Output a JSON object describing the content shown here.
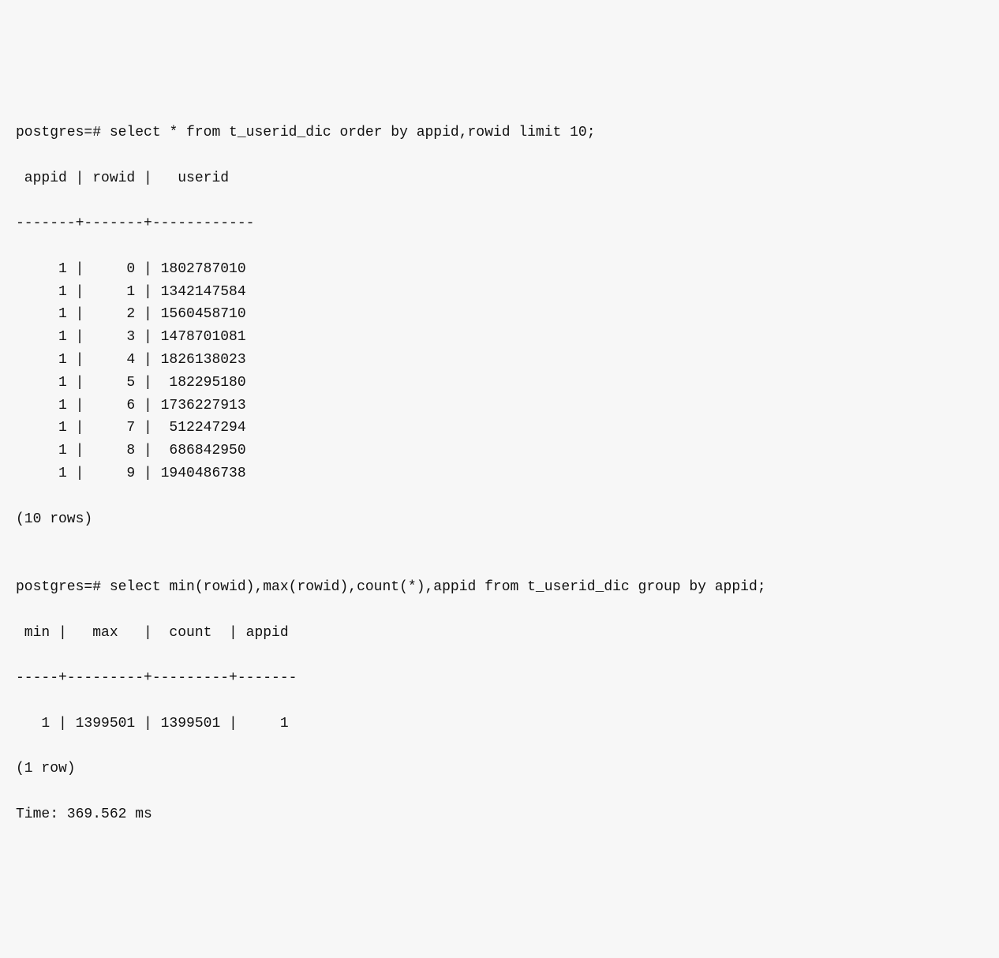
{
  "q1": {
    "prompt": "postgres=# ",
    "sql": "select * from t_userid_dic order by appid,rowid limit 10;",
    "header": " appid | rowid |   userid",
    "separator": "-------+-------+------------",
    "rows": [
      {
        "appid": "1",
        "rowid": "0",
        "userid": "1802787010"
      },
      {
        "appid": "1",
        "rowid": "1",
        "userid": "1342147584"
      },
      {
        "appid": "1",
        "rowid": "2",
        "userid": "1560458710"
      },
      {
        "appid": "1",
        "rowid": "3",
        "userid": "1478701081"
      },
      {
        "appid": "1",
        "rowid": "4",
        "userid": "1826138023"
      },
      {
        "appid": "1",
        "rowid": "5",
        "userid": "182295180"
      },
      {
        "appid": "1",
        "rowid": "6",
        "userid": "1736227913"
      },
      {
        "appid": "1",
        "rowid": "7",
        "userid": "512247294"
      },
      {
        "appid": "1",
        "rowid": "8",
        "userid": "686842950"
      },
      {
        "appid": "1",
        "rowid": "9",
        "userid": "1940486738"
      }
    ],
    "footer": "(10 rows)"
  },
  "blank": "",
  "q2": {
    "prompt": "postgres=# ",
    "sql": "select min(rowid),max(rowid),count(*),appid from t_userid_dic group by appid;",
    "header": " min |   max   |  count  | appid",
    "separator": "-----+---------+---------+-------",
    "rows": [
      {
        "min": "1",
        "max": "1399501",
        "count": "1399501",
        "appid": "1"
      }
    ],
    "footer": "(1 row)",
    "timing": "Time: 369.562 ms"
  }
}
